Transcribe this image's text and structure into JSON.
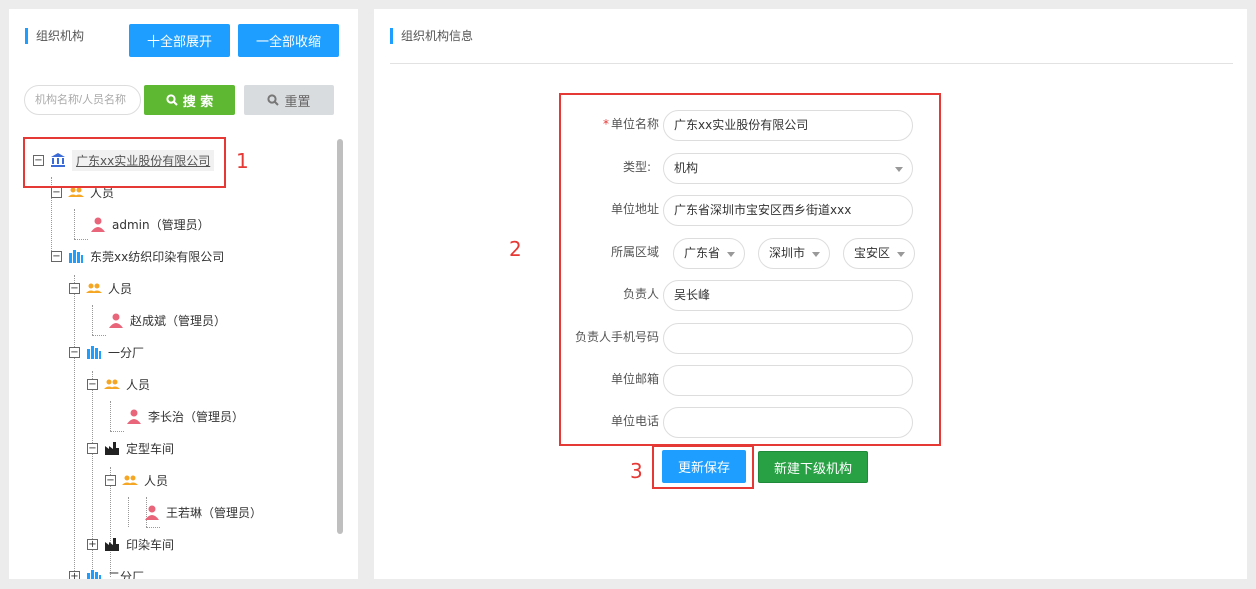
{
  "left": {
    "title": "组织机构",
    "expand_all": "十全部展开",
    "collapse_all": "一全部收缩",
    "search_placeholder": "机构名称/人员名称",
    "search_btn": "搜 索",
    "reset_btn": "重置"
  },
  "tree": {
    "root": "广东xx实业股份有限公司",
    "staff": "人员",
    "admin": "admin（管理员）",
    "dongguan": "东莞xx纺织印染有限公司",
    "staff2": "人员",
    "zhao": "赵成斌（管理员）",
    "fen1": "一分厂",
    "staff3": "人员",
    "li": "李长治（管理员）",
    "dingxing": "定型车间",
    "staff4": "人员",
    "wang": "王若琳（管理员）",
    "yinran": "印染车间",
    "fen2": "二分厂"
  },
  "right": {
    "title": "组织机构信息",
    "labels": {
      "name": "单位名称",
      "type": "类型:",
      "address": "单位地址",
      "region": "所属区域",
      "leader": "负责人",
      "phone": "负责人手机号码",
      "email": "单位邮箱",
      "tel": "单位电话"
    },
    "values": {
      "name": "广东xx实业股份有限公司",
      "type": "机构",
      "address": "广东省深圳市宝安区西乡街道xxx",
      "province": "广东省",
      "city": "深圳市",
      "district": "宝安区",
      "leader": "吴长峰",
      "phone": "",
      "email": "",
      "tel": ""
    },
    "save_btn": "更新保存",
    "new_btn": "新建下级机构"
  },
  "markers": {
    "m1": "1",
    "m2": "2",
    "m3": "3"
  },
  "colors": {
    "blue": "#1e9fff",
    "green": "#5fb832",
    "dark_green": "#28a145",
    "highlight": "#e53935"
  }
}
